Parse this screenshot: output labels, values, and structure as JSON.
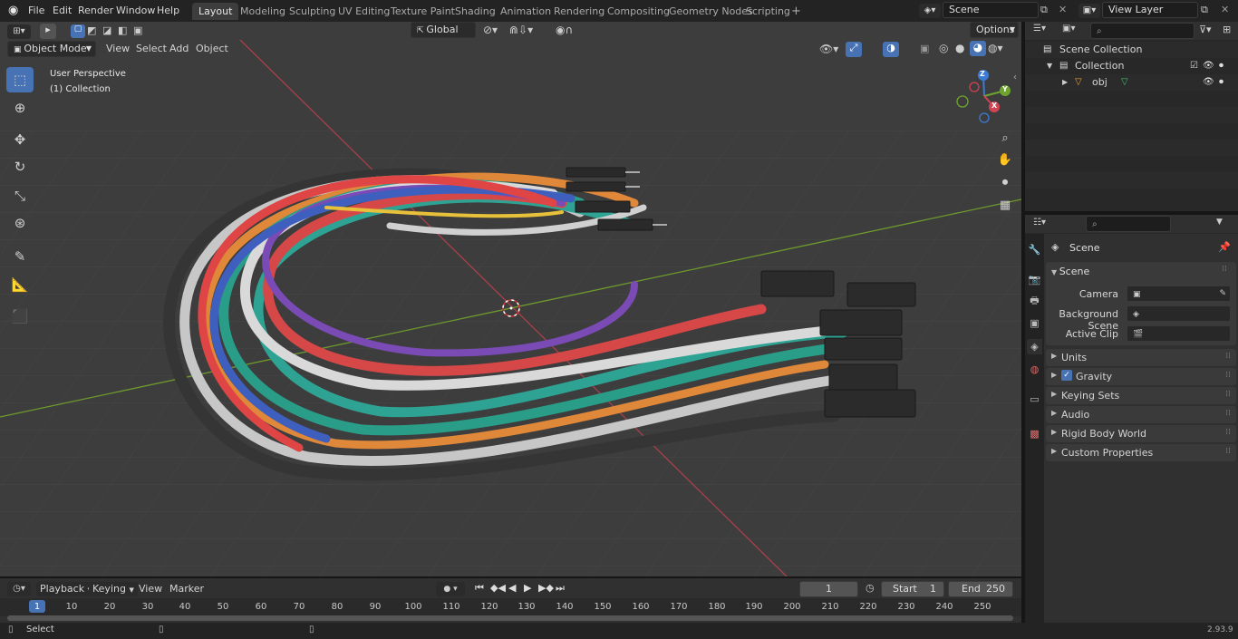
{
  "topbar": {
    "menus": [
      "File",
      "Edit",
      "Render",
      "Window",
      "Help"
    ],
    "workspaces": [
      "Layout",
      "Modeling",
      "Sculpting",
      "UV Editing",
      "Texture Paint",
      "Shading",
      "Animation",
      "Rendering",
      "Compositing",
      "Geometry Nodes",
      "Scripting"
    ],
    "active_workspace": "Layout",
    "add_tab": "+",
    "scene_name": "Scene",
    "view_layer": "View Layer"
  },
  "viewport": {
    "mode": "Object Mode",
    "menus": [
      "View",
      "Select",
      "Add",
      "Object"
    ],
    "transform_orientation": "Global",
    "options_label": "Options",
    "overlay_title": "User Perspective",
    "overlay_collection": "(1) Collection",
    "gizmo_axes": [
      "Z",
      "Y",
      "X"
    ]
  },
  "outliner": {
    "root": "Scene Collection",
    "collection": "Collection",
    "object": "obj"
  },
  "properties": {
    "context": "Scene",
    "panel": "Scene",
    "fields": [
      {
        "label": "Camera",
        "value": ""
      },
      {
        "label": "Background Scene",
        "value": ""
      },
      {
        "label": "Active Clip",
        "value": ""
      }
    ],
    "subpanels": [
      "Units",
      "Gravity",
      "Keying Sets",
      "Audio",
      "Rigid Body World",
      "Custom Properties"
    ],
    "gravity_enabled": true
  },
  "timeline": {
    "menus": [
      "Playback",
      "Keying",
      "View",
      "Marker"
    ],
    "current_frame": "1",
    "start_label": "Start",
    "start": "1",
    "end_label": "End",
    "end": "250",
    "ticks": [
      "1",
      "10",
      "20",
      "30",
      "40",
      "50",
      "60",
      "70",
      "80",
      "90",
      "100",
      "110",
      "120",
      "130",
      "140",
      "150",
      "160",
      "170",
      "180",
      "190",
      "200",
      "210",
      "220",
      "230",
      "240",
      "250"
    ]
  },
  "statusbar": {
    "left": "Select",
    "version": "2.93.9"
  },
  "colors": {
    "accent": "#4772b3",
    "viewport_bg": "#3e3e3e",
    "x_axis": "#b3424b",
    "y_axis": "#6e9a2d",
    "playhead": "#4772b3"
  }
}
